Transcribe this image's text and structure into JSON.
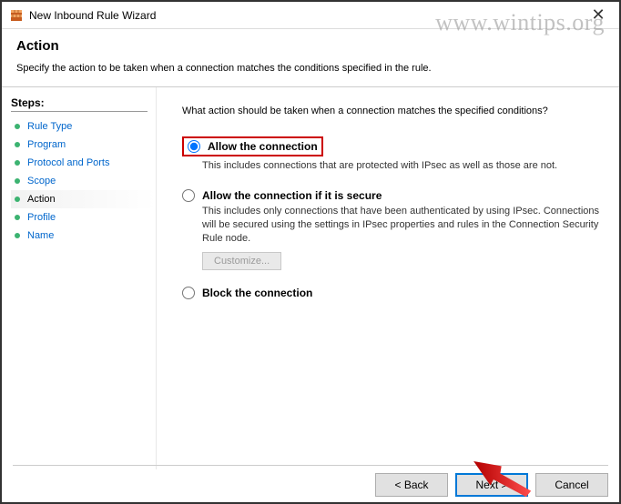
{
  "window": {
    "title": "New Inbound Rule Wizard"
  },
  "header": {
    "title": "Action",
    "desc": "Specify the action to be taken when a connection matches the conditions specified in the rule."
  },
  "sidebar": {
    "title": "Steps:",
    "items": [
      {
        "label": "Rule Type",
        "current": false
      },
      {
        "label": "Program",
        "current": false
      },
      {
        "label": "Protocol and Ports",
        "current": false
      },
      {
        "label": "Scope",
        "current": false
      },
      {
        "label": "Action",
        "current": true
      },
      {
        "label": "Profile",
        "current": false
      },
      {
        "label": "Name",
        "current": false
      }
    ]
  },
  "main": {
    "prompt": "What action should be taken when a connection matches the specified conditions?",
    "options": {
      "allow": {
        "label": "Allow the connection",
        "desc": "This includes connections that are protected with IPsec as well as those are not."
      },
      "allow_secure": {
        "label": "Allow the connection if it is secure",
        "desc": "This includes only connections that have been authenticated by using IPsec. Connections will be secured using the settings in IPsec properties and rules in the Connection Security Rule node.",
        "customize": "Customize..."
      },
      "block": {
        "label": "Block the connection"
      }
    }
  },
  "footer": {
    "back": "< Back",
    "next": "Next >",
    "cancel": "Cancel"
  },
  "watermark": "www.wintips.org"
}
